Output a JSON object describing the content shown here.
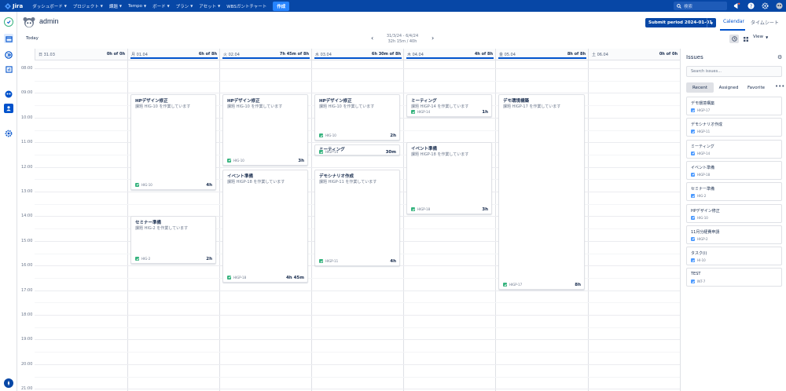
{
  "app": {
    "name": "Jira"
  },
  "topnav": {
    "items": [
      "ダッシュボード",
      "プロジェクト",
      "課題",
      "Tempo",
      "ボード",
      "プラン",
      "アセット",
      "WBSガントチャート"
    ],
    "create_label": "作成",
    "search_placeholder": "検索"
  },
  "header": {
    "username": "admin",
    "submit_label": "Submit period 2024-01-01",
    "tabs": [
      "Calendar",
      "タイムシート"
    ],
    "today_label": "Today",
    "date_range": "31/3/24 - 6/4/24",
    "logged_summary": "32h 15m / 40h",
    "view_label": "View"
  },
  "calendar": {
    "days": [
      {
        "label": "日 31.03",
        "hours": "0h of 0h",
        "progress": 0
      },
      {
        "label": "月 01.04",
        "hours": "6h of 8h",
        "progress": 1
      },
      {
        "label": "火 02.04",
        "hours": "7h 45m of 8h",
        "progress": 1
      },
      {
        "label": "水 03.04",
        "hours": "6h 30m of 8h",
        "progress": 1
      },
      {
        "label": "木 04.04",
        "hours": "4h of 8h",
        "progress": 1
      },
      {
        "label": "金 05.04",
        "hours": "8h of 8h",
        "progress": 1
      },
      {
        "label": "土 06.04",
        "hours": "0h of 0h",
        "progress": 0
      }
    ],
    "times": [
      "08:00",
      "09:00",
      "10:00",
      "11:00",
      "12:00",
      "13:00",
      "14:00",
      "15:00",
      "16:00",
      "17:00",
      "18:00",
      "19:00",
      "20:00",
      "21:00"
    ],
    "events": [
      {
        "day": 1,
        "title": "HPデザイン修正",
        "desc": "課題 HIG-10 を作業しています",
        "key": "HIG-10",
        "dur": "4h"
      },
      {
        "day": 1,
        "title": "セミナー準備",
        "desc": "課題 HIG-2 を作業しています",
        "key": "HIG-2",
        "dur": "2h"
      },
      {
        "day": 2,
        "title": "HPデザイン修正",
        "desc": "課題 HIG-10 を作業しています",
        "key": "HIG-10",
        "dur": "3h"
      },
      {
        "day": 2,
        "title": "イベント準備",
        "desc": "課題 HIGP-18 を作業しています",
        "key": "HIGP-18",
        "dur": "4h 45m"
      },
      {
        "day": 3,
        "title": "HPデザイン修正",
        "desc": "課題 HIG-10 を作業しています",
        "key": "HIG-10",
        "dur": "2h"
      },
      {
        "day": 3,
        "title": "ミーティング",
        "desc": "",
        "key": "HIGP-14",
        "dur": "30m"
      },
      {
        "day": 3,
        "title": "デモシナリオ作成",
        "desc": "課題 HIGP-11 を作業しています",
        "key": "HIGP-11",
        "dur": "4h"
      },
      {
        "day": 4,
        "title": "ミーティング",
        "desc": "課題 HIGP-14 を作業しています",
        "key": "HIGP-14",
        "dur": "1h"
      },
      {
        "day": 4,
        "title": "イベント準備",
        "desc": "課題 HIGP-18 を作業しています",
        "key": "HIGP-18",
        "dur": "3h"
      },
      {
        "day": 5,
        "title": "デモ環境構築",
        "desc": "課題 HIGP-17 を作業しています",
        "key": "HIGP-17",
        "dur": "8h"
      }
    ]
  },
  "issues_panel": {
    "title": "Issues",
    "search_placeholder": "Search issues...",
    "tabs": [
      "Recent",
      "Assigned",
      "Favorite"
    ],
    "items": [
      {
        "title": "デモ環境構築",
        "key": "HIGP-17"
      },
      {
        "title": "デモシナリオ作成",
        "key": "HIGP-11"
      },
      {
        "title": "ミーティング",
        "key": "HIGP-14"
      },
      {
        "title": "イベント準備",
        "key": "HIGP-18"
      },
      {
        "title": "セミナー準備",
        "key": "HIG-2"
      },
      {
        "title": "HPデザイン修正",
        "key": "HIG-10"
      },
      {
        "title": "11月分経費申請",
        "key": "HIGP-2"
      },
      {
        "title": "タスク(i)",
        "key": "HI-10"
      },
      {
        "title": "TEST",
        "key": "INT-7"
      }
    ]
  },
  "colors": {
    "nav_bg": "#0747a6",
    "accent": "#0052cc",
    "done": "#36b37e"
  }
}
